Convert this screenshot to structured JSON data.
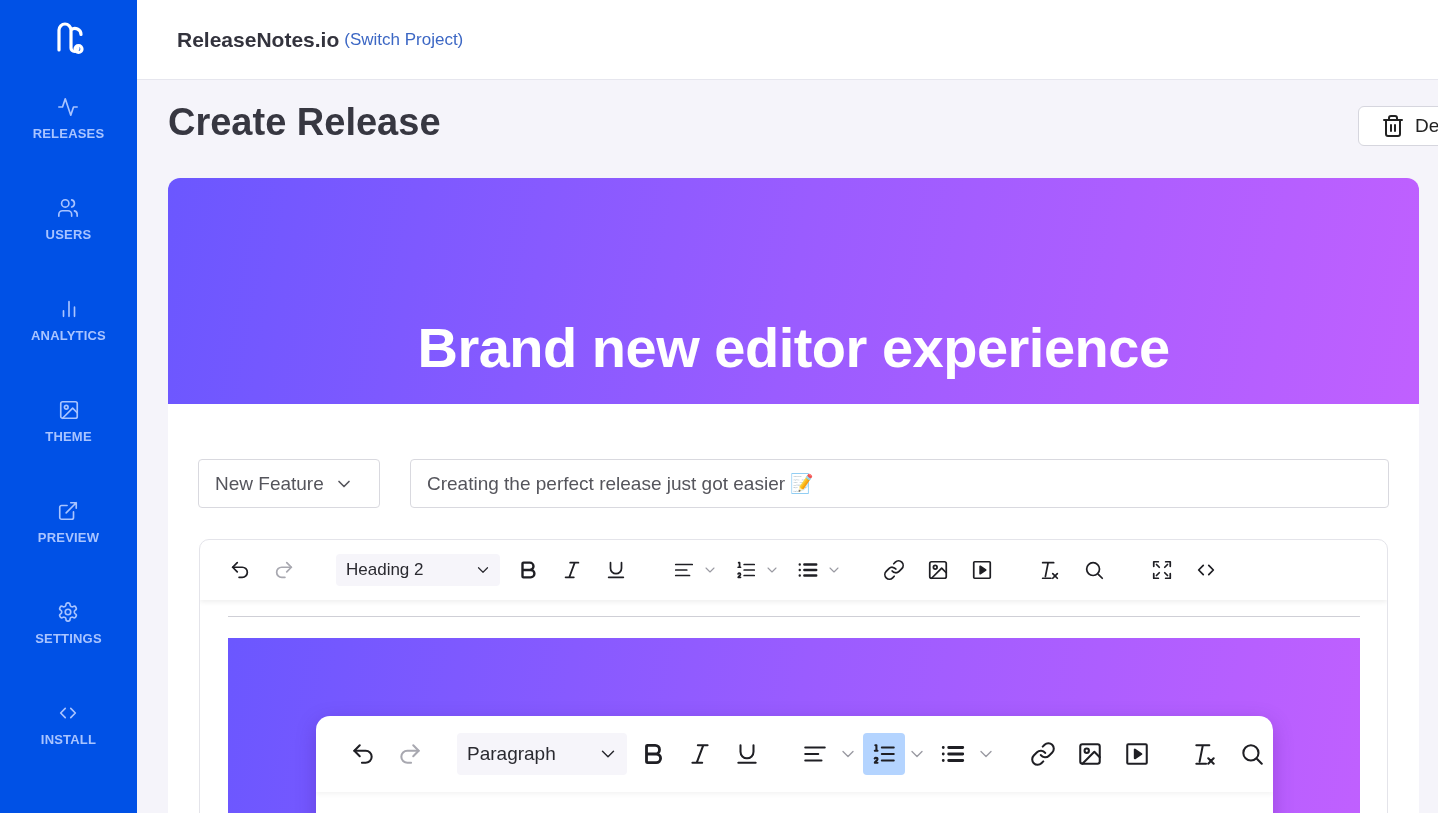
{
  "sidebar": {
    "items": [
      {
        "kind": "activity",
        "label": "RELEASES"
      },
      {
        "kind": "users",
        "label": "USERS"
      },
      {
        "kind": "chart",
        "label": "ANALYTICS"
      },
      {
        "kind": "image",
        "label": "THEME"
      },
      {
        "kind": "external",
        "label": "PREVIEW"
      },
      {
        "kind": "settings",
        "label": "SETTINGS"
      },
      {
        "kind": "code",
        "label": "INSTALL"
      }
    ]
  },
  "header": {
    "project": "ReleaseNotes.io",
    "switch_link": "(Switch Project)"
  },
  "page": {
    "title": "Create Release",
    "delete_button": "De"
  },
  "release": {
    "banner_title": "Brand new editor experience",
    "category": {
      "value": "New Feature"
    },
    "title_field": {
      "value": "Creating the perfect release just got easier 📝"
    },
    "editor": {
      "toolbar": {
        "groups": [
          [
            {
              "kind": "undo",
              "disabled": false,
              "active": false
            },
            {
              "kind": "redo",
              "disabled": true,
              "active": false
            }
          ],
          [
            {
              "kind": "block-select",
              "label": "Heading 2",
              "disabled": false,
              "active": false
            },
            {
              "kind": "bold",
              "disabled": false,
              "active": false
            },
            {
              "kind": "italic",
              "disabled": false,
              "active": false
            },
            {
              "kind": "underline",
              "disabled": false,
              "active": false
            }
          ],
          [
            {
              "kind": "align",
              "disabled": false,
              "active": false
            },
            {
              "kind": "numbered-list",
              "disabled": false,
              "active": false
            },
            {
              "kind": "bullet-list",
              "disabled": false,
              "active": false
            }
          ],
          [
            {
              "kind": "link",
              "disabled": false,
              "active": false
            },
            {
              "kind": "image",
              "disabled": false,
              "active": false
            },
            {
              "kind": "video",
              "disabled": false,
              "active": false
            }
          ],
          [
            {
              "kind": "clear-format",
              "disabled": false,
              "active": false
            },
            {
              "kind": "search",
              "disabled": false,
              "active": false
            }
          ],
          [
            {
              "kind": "fullscreen",
              "disabled": false,
              "active": false
            },
            {
              "kind": "code",
              "disabled": false,
              "active": false
            }
          ]
        ]
      },
      "screenshot": {
        "toolbar": {
          "groups": [
            [
              {
                "kind": "undo",
                "disabled": false,
                "active": false
              },
              {
                "kind": "redo",
                "disabled": true,
                "active": false
              }
            ],
            [
              {
                "kind": "block-select",
                "label": "Paragraph",
                "disabled": false,
                "active": false
              },
              {
                "kind": "bold",
                "disabled": false,
                "active": false
              },
              {
                "kind": "italic",
                "disabled": false,
                "active": false
              },
              {
                "kind": "underline",
                "disabled": false,
                "active": false
              }
            ],
            [
              {
                "kind": "align",
                "disabled": false,
                "active": false
              },
              {
                "kind": "numbered-list",
                "disabled": false,
                "active": true
              },
              {
                "kind": "bullet-list",
                "disabled": false,
                "active": false
              }
            ],
            [
              {
                "kind": "link",
                "disabled": false,
                "active": false
              },
              {
                "kind": "image",
                "disabled": false,
                "active": false
              },
              {
                "kind": "video",
                "disabled": false,
                "active": false
              }
            ],
            [
              {
                "kind": "clear-format",
                "disabled": false,
                "active": false
              },
              {
                "kind": "search",
                "disabled": false,
                "active": false
              }
            ]
          ]
        }
      }
    }
  }
}
